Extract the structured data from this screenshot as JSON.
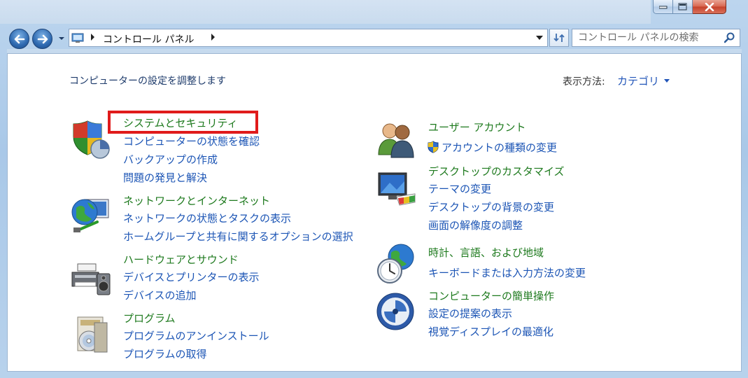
{
  "address": {
    "breadcrumb": "コントロール パネル"
  },
  "search": {
    "placeholder": "コントロール パネルの検索"
  },
  "header": {
    "title": "コンピューターの設定を調整します",
    "view_label": "表示方法:",
    "view_value": "カテゴリ"
  },
  "categories": {
    "system": {
      "title": "システムとセキュリティ",
      "links": [
        "コンピューターの状態を確認",
        "バックアップの作成",
        "問題の発見と解決"
      ]
    },
    "network": {
      "title": "ネットワークとインターネット",
      "links": [
        "ネットワークの状態とタスクの表示",
        "ホームグループと共有に関するオプションの選択"
      ]
    },
    "hardware": {
      "title": "ハードウェアとサウンド",
      "links": [
        "デバイスとプリンターの表示",
        "デバイスの追加"
      ]
    },
    "programs": {
      "title": "プログラム",
      "links": [
        "プログラムのアンインストール",
        "プログラムの取得"
      ]
    },
    "users": {
      "title": "ユーザー アカウント",
      "links": [
        "アカウントの種類の変更"
      ]
    },
    "appearance": {
      "title": "デスクトップのカスタマイズ",
      "links": [
        "テーマの変更",
        "デスクトップの背景の変更",
        "画面の解像度の調整"
      ]
    },
    "clock": {
      "title": "時計、言語、および地域",
      "links": [
        "キーボードまたは入力方法の変更"
      ]
    },
    "ease": {
      "title": "コンピューターの簡単操作",
      "links": [
        "設定の提案の表示",
        "視覚ディスプレイの最適化"
      ]
    }
  },
  "colors": {
    "category_title": "#1e7a1e",
    "link": "#1c55b5",
    "highlight": "#e01b1b"
  }
}
